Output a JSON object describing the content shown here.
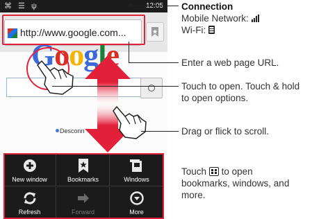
{
  "status_bar": {
    "left_icons": "⌘ ☰ ψ",
    "right_icons": "H ▂▃▅",
    "time": "12:05"
  },
  "browser": {
    "url": "http://www.google.com...",
    "logo": "Google",
    "disconnect_link": "Desconn"
  },
  "menu": {
    "items": [
      {
        "label": "New window",
        "icon": "plus-circle-icon"
      },
      {
        "label": "Bookmarks",
        "icon": "bookmark-star-icon"
      },
      {
        "label": "Windows",
        "icon": "windows-icon"
      },
      {
        "label": "Refresh",
        "icon": "refresh-icon"
      },
      {
        "label": "Forward",
        "icon": "forward-arrow-icon"
      },
      {
        "label": "More",
        "icon": "chevron-down-circle-icon"
      }
    ]
  },
  "callouts": {
    "connection": {
      "title": "Connection",
      "mobile_network": "Mobile Network:",
      "wifi": "Wi-Fi:"
    },
    "url": "Enter a web page URL.",
    "touch_line1": "Touch to open. Touch & hold",
    "touch_line2": "to open options.",
    "scroll": "Drag or flick to scroll.",
    "menu_line1_pre": "Touch",
    "menu_line1_post": "to open",
    "menu_line2": "bookmarks, windows, and",
    "menu_line3": "more."
  },
  "colors": {
    "highlight": "#e5203a",
    "menu_bg": "#1b1b1b"
  }
}
